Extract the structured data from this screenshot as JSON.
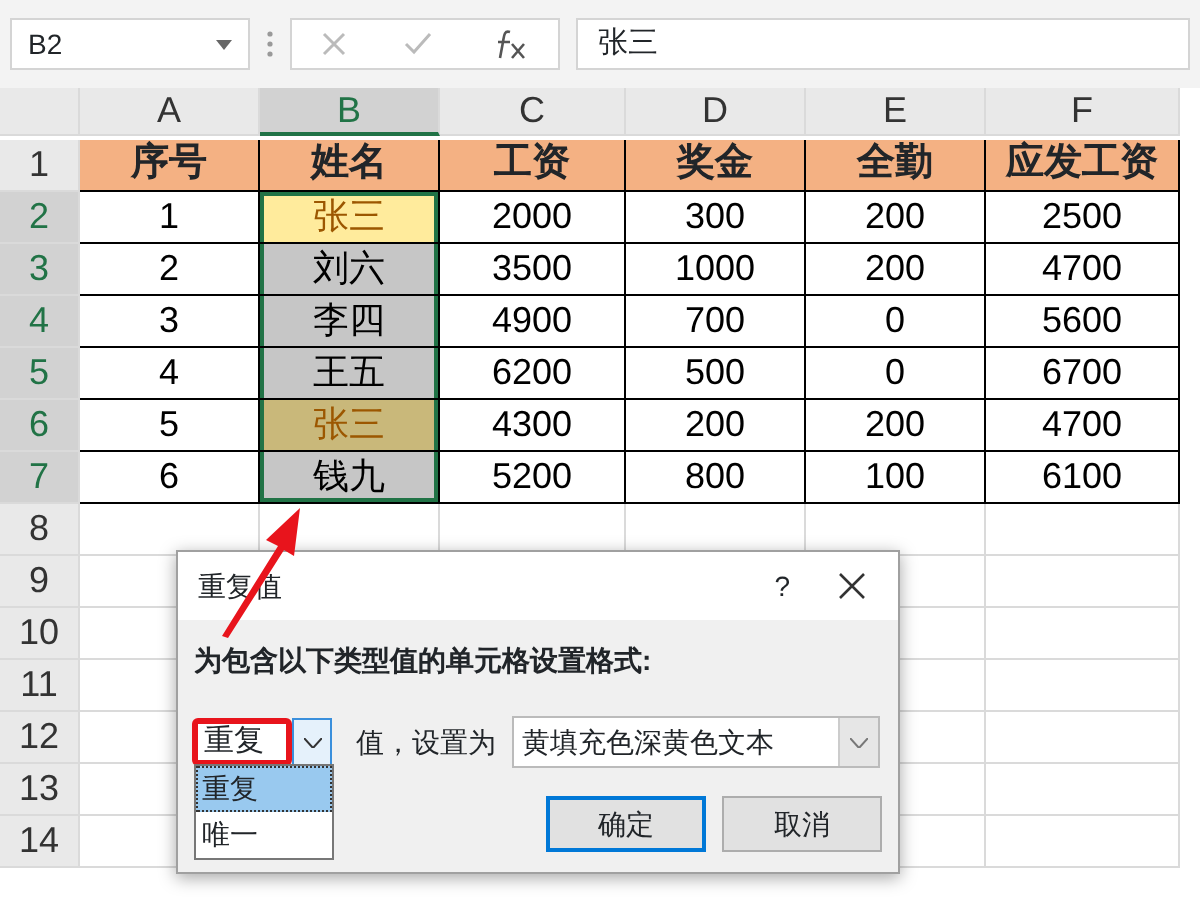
{
  "formula_bar": {
    "name_box": "B2",
    "formula": "张三"
  },
  "columns": [
    {
      "label": "A",
      "selected": false
    },
    {
      "label": "B",
      "selected": true
    },
    {
      "label": "C",
      "selected": false
    },
    {
      "label": "D",
      "selected": false
    },
    {
      "label": "E",
      "selected": false
    },
    {
      "label": "F",
      "selected": false
    }
  ],
  "rows": [
    {
      "number": "1",
      "selected": false,
      "kind": "header",
      "cells": [
        "序号",
        "姓名",
        "工资",
        "奖金",
        "全勤",
        "应发工资"
      ]
    },
    {
      "number": "2",
      "selected": true,
      "kind": "data",
      "active": true,
      "duplicate": true,
      "cells": [
        "1",
        "张三",
        "2000",
        "300",
        "200",
        "2500"
      ]
    },
    {
      "number": "3",
      "selected": true,
      "kind": "data",
      "active": false,
      "duplicate": false,
      "cells": [
        "2",
        "刘六",
        "3500",
        "1000",
        "200",
        "4700"
      ]
    },
    {
      "number": "4",
      "selected": true,
      "kind": "data",
      "active": false,
      "duplicate": false,
      "cells": [
        "3",
        "李四",
        "4900",
        "700",
        "0",
        "5600"
      ]
    },
    {
      "number": "5",
      "selected": true,
      "kind": "data",
      "active": false,
      "duplicate": false,
      "cells": [
        "4",
        "王五",
        "6200",
        "500",
        "0",
        "6700"
      ]
    },
    {
      "number": "6",
      "selected": true,
      "kind": "data",
      "active": false,
      "duplicate": true,
      "cells": [
        "5",
        "张三",
        "4300",
        "200",
        "200",
        "4700"
      ]
    },
    {
      "number": "7",
      "selected": true,
      "kind": "data",
      "active": false,
      "duplicate": false,
      "cells": [
        "6",
        "钱九",
        "5200",
        "800",
        "100",
        "6100"
      ]
    },
    {
      "number": "8",
      "selected": false,
      "kind": "empty"
    },
    {
      "number": "9",
      "selected": false,
      "kind": "empty"
    },
    {
      "number": "10",
      "selected": false,
      "kind": "empty"
    },
    {
      "number": "11",
      "selected": false,
      "kind": "empty"
    },
    {
      "number": "12",
      "selected": false,
      "kind": "empty"
    },
    {
      "number": "13",
      "selected": false,
      "kind": "empty"
    },
    {
      "number": "14",
      "selected": false,
      "kind": "empty"
    }
  ],
  "dialog": {
    "title": "重复值",
    "help": "?",
    "instruction": "为包含以下类型值的单元格设置格式:",
    "rule_select": {
      "value": "重复",
      "highlighted": true,
      "expanded": true
    },
    "options": [
      {
        "label": "重复",
        "selected": true
      },
      {
        "label": "唯一",
        "selected": false
      }
    ],
    "values_label": "值，设置为",
    "format_select": {
      "value": "黄填充色深黄色文本"
    },
    "buttons": [
      {
        "label": "确定",
        "default": true
      },
      {
        "label": "取消",
        "default": false
      }
    ]
  }
}
